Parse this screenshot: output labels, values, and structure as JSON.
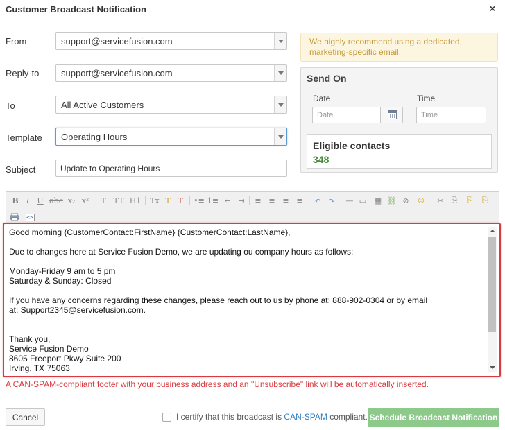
{
  "dialog": {
    "title": "Customer Broadcast Notification",
    "close_glyph": "×"
  },
  "form": {
    "from": {
      "label": "From",
      "value": "support@servicefusion.com"
    },
    "reply_to": {
      "label": "Reply-to",
      "value": "support@servicefusion.com"
    },
    "to": {
      "label": "To",
      "value": "All Active Customers"
    },
    "template": {
      "label": "Template",
      "value": "Operating Hours"
    },
    "subject": {
      "label": "Subject",
      "value": "Update to Operating Hours"
    }
  },
  "notice": {
    "text": "We highly recommend using a dedicated, marketing-specific email.",
    "color": "#c49a3a"
  },
  "send_on": {
    "title": "Send On",
    "date_label": "Date",
    "time_label": "Time",
    "date_placeholder": "Date",
    "time_placeholder": "Time"
  },
  "eligible": {
    "title": "Eligible contacts",
    "count": "348",
    "color": "#4a8a3e"
  },
  "toolbar": {
    "row1": [
      "B",
      "I",
      "U",
      "abc",
      "x₂",
      "x²",
      "T",
      "TT",
      "H1",
      "Tx",
      "T",
      "T",
      "•≡",
      "1≡",
      "⇤",
      "⇥",
      "≡",
      "≡",
      "≡",
      "≡",
      "↶",
      "↷",
      "—",
      "▭",
      "▦",
      "⛓",
      "⊘",
      "☺",
      "✂",
      "⎘",
      "⎘",
      "⎘"
    ],
    "row2_icons": [
      "print-icon",
      "source-icon"
    ]
  },
  "editor": {
    "lines": [
      "Good morning {CustomerContact:FirstName} {CustomerContact:LastName},",
      "",
      "Due to changes here at Service Fusion Demo, we are updating ou company hours as follows:",
      "",
      "Monday-Friday 9 am to 5 pm",
      "Saturday & Sunday: Closed",
      "",
      "If you have any concerns regarding these changes, please reach out to us by phone at: 888-902-0304 or by email",
      "at: Support2345@servicefusion.com.",
      "",
      "",
      "Thank you,",
      "Service Fusion Demo",
      "8605 Freeport Pkwy Suite 200",
      "Irving, TX 75063"
    ],
    "highlight_color": "#d9393f"
  },
  "canspam_note": "A CAN-SPAM-compliant footer with your business address and an \"Unsubscribe\" link will be automatically inserted.",
  "footer": {
    "cancel_label": "Cancel",
    "certify_prefix": "I certify that this broadcast is ",
    "certify_link": "CAN-SPAM",
    "certify_suffix": " compliant.",
    "schedule_label": "Schedule Broadcast Notification",
    "schedule_color": "#8cc98a"
  }
}
